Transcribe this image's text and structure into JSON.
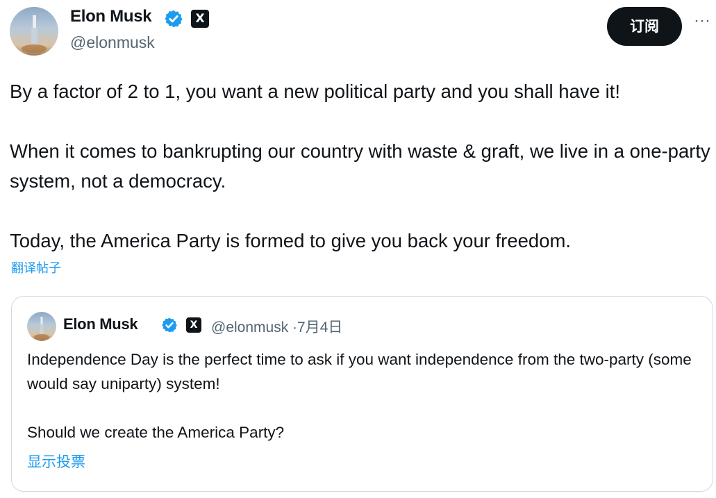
{
  "post": {
    "author_name": "Elon Musk",
    "author_handle": "@elonmusk",
    "subscribe_label": "订阅",
    "more_label": "···",
    "x_badge": "X",
    "paragraphs": [
      "By a factor of 2 to 1, you want a new political party and you shall have it!",
      "When it comes to bankrupting our country with waste & graft, we live in a one-party system, not a democracy.",
      "Today, the America Party is formed to give you back your freedom."
    ],
    "translate_label": "翻译帖子"
  },
  "quote": {
    "author_name": "Elon Musk",
    "x_badge": "X",
    "author_handle": "@elonmusk",
    "separator": "·",
    "date": "7月4日",
    "paragraphs": [
      "Independence Day is the perfect time to ask if you want independence from the two-party (some would say uniparty) system!",
      "Should we create the America Party?"
    ],
    "show_poll_label": "显示投票"
  },
  "colors": {
    "verified_blue": "#1d9bf0",
    "text_primary": "#0f1419",
    "text_secondary": "#536471",
    "link_blue": "#1d9bf0",
    "border": "#cfd9de"
  },
  "icons": [
    "avatar",
    "verified-badge-icon",
    "x-logo-badge",
    "more-options-icon"
  ]
}
